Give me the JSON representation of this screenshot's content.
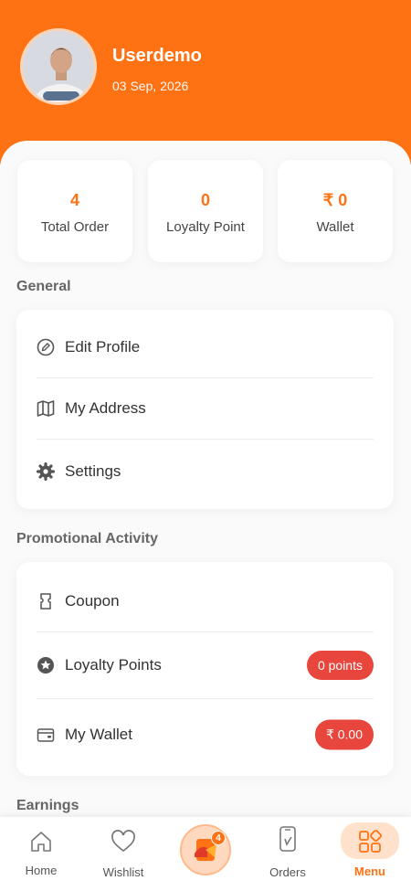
{
  "profile": {
    "name": "Userdemo",
    "date": "03 Sep, 2026"
  },
  "stats": [
    {
      "value": "4",
      "label": "Total Order"
    },
    {
      "value": "0",
      "label": "Loyalty Point"
    },
    {
      "value": "₹ 0",
      "label": "Wallet"
    }
  ],
  "general": {
    "title": "General",
    "items": [
      {
        "label": "Edit Profile",
        "icon": "edit-icon"
      },
      {
        "label": "My Address",
        "icon": "map-icon"
      },
      {
        "label": "Settings",
        "icon": "gear-icon"
      }
    ]
  },
  "promo": {
    "title": "Promotional Activity",
    "items": [
      {
        "label": "Coupon",
        "icon": "coupon-icon"
      },
      {
        "label": "Loyalty Points",
        "icon": "star-icon",
        "pill": "0 points"
      },
      {
        "label": "My Wallet",
        "icon": "wallet-icon",
        "pill": "₹ 0.00"
      }
    ]
  },
  "earnings": {
    "title": "Earnings"
  },
  "nav": {
    "home": "Home",
    "wishlist": "Wishlist",
    "cart_count": "4",
    "orders": "Orders",
    "menu": "Menu"
  },
  "colors": {
    "accent": "#ff7214",
    "pill": "#e8453c"
  }
}
